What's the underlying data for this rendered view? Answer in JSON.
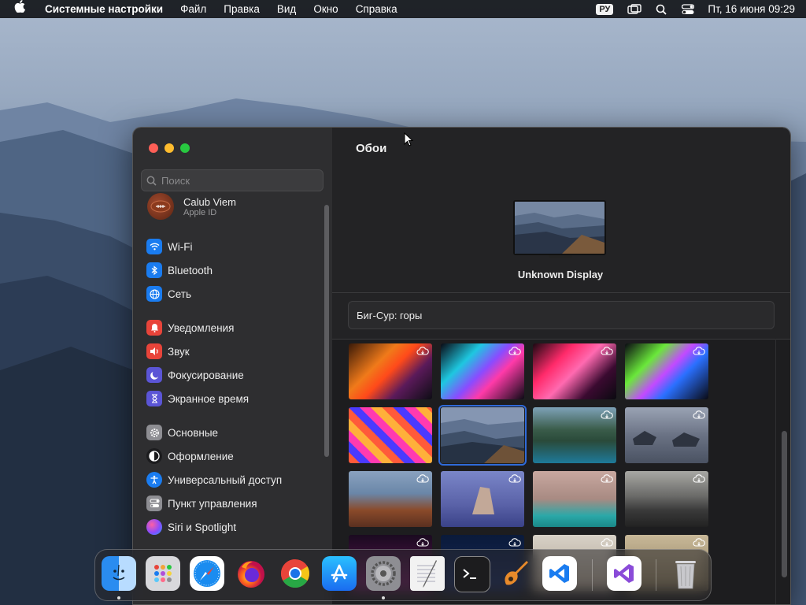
{
  "menubar": {
    "app_name": "Системные настройки",
    "menus": [
      "Файл",
      "Правка",
      "Вид",
      "Окно",
      "Справка"
    ],
    "input_language": "РУ",
    "clock": "Пт, 16 июня  09:29"
  },
  "sidebar": {
    "search_placeholder": "Поиск",
    "account": {
      "name": "Calub Viem",
      "subtitle": "Apple ID"
    },
    "groups": [
      [
        {
          "label": "Wi-Fi",
          "icon": "wifi-icon",
          "color": "#1a7cf0"
        },
        {
          "label": "Bluetooth",
          "icon": "bluetooth-icon",
          "color": "#1a7cf0"
        },
        {
          "label": "Сеть",
          "icon": "globe-icon",
          "color": "#1a7cf0"
        }
      ],
      [
        {
          "label": "Уведомления",
          "icon": "bell-icon",
          "color": "#e8443a"
        },
        {
          "label": "Звук",
          "icon": "speaker-icon",
          "color": "#e8443a"
        },
        {
          "label": "Фокусирование",
          "icon": "moon-icon",
          "color": "#5b55d6"
        },
        {
          "label": "Экранное время",
          "icon": "hourglass-icon",
          "color": "#5b55d6"
        }
      ],
      [
        {
          "label": "Основные",
          "icon": "gear-icon",
          "color": "#8e8e93"
        },
        {
          "label": "Оформление",
          "icon": "appearance-icon",
          "color": "#1c1c1e"
        },
        {
          "label": "Универсальный доступ",
          "icon": "accessibility-icon",
          "color": "#1a7cf0"
        },
        {
          "label": "Пункт управления",
          "icon": "control-center-icon",
          "color": "#8e8e93"
        },
        {
          "label": "Siri и Spotlight",
          "icon": "siri-icon",
          "color": "#b04fd8"
        }
      ]
    ]
  },
  "main": {
    "title": "Обои",
    "display_name": "Unknown Display",
    "wallpaper_collection": "Биг-Сур: горы"
  },
  "dock": {
    "apps": [
      "Finder",
      "Launchpad",
      "Safari",
      "Firefox",
      "Chrome",
      "App Store",
      "Системные настройки",
      "TextEdit",
      "Терминал",
      "GarageBand",
      "Visual Studio Code",
      "Visual Studio",
      "Корзина"
    ]
  },
  "colors": {
    "accent": "#2f6ad9",
    "window_bg": "#232325",
    "sidebar_bg": "#2e2e30"
  }
}
